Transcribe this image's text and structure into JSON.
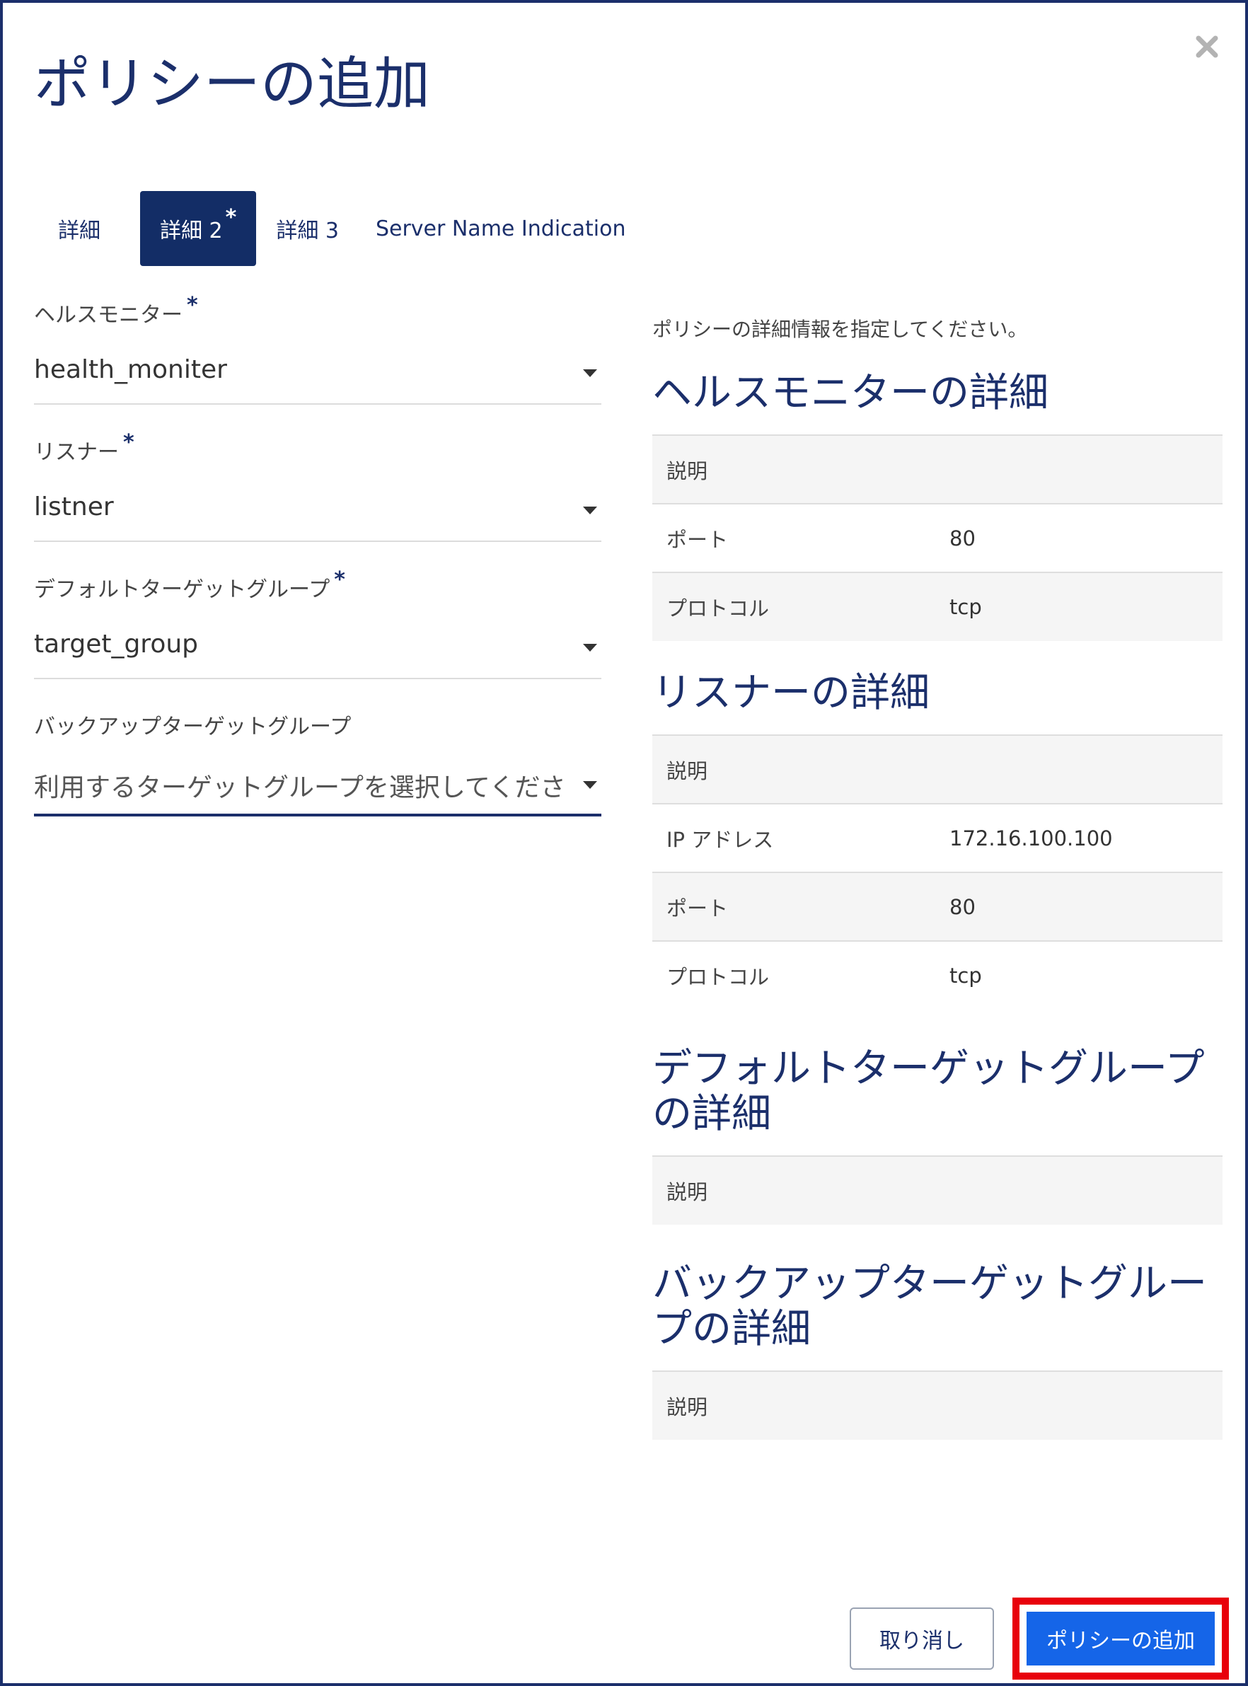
{
  "dialog": {
    "title": "ポリシーの追加",
    "close_icon": "close-icon"
  },
  "tabs": [
    {
      "label": "詳細",
      "active": false
    },
    {
      "label": "詳細 2",
      "active": true,
      "required_mark": "*"
    },
    {
      "label": "詳細 3",
      "active": false
    },
    {
      "label": "Server Name Indication",
      "active": false
    }
  ],
  "form": {
    "health_monitor": {
      "label": "ヘルスモニター",
      "required": "*",
      "value": "health_moniter"
    },
    "listener": {
      "label": "リスナー",
      "required": "*",
      "value": "listner"
    },
    "default_target_group": {
      "label": "デフォルトターゲットグループ",
      "required": "*",
      "value": "target_group"
    },
    "backup_target_group": {
      "label": "バックアップターゲットグループ",
      "placeholder": "利用するターゲットグループを選択してくださ"
    }
  },
  "details": {
    "intro": "ポリシーの詳細情報を指定してください。",
    "health_monitor": {
      "title": "ヘルスモニターの詳細",
      "rows": [
        {
          "key": "説明",
          "value": ""
        },
        {
          "key": "ポート",
          "value": "80"
        },
        {
          "key": "プロトコル",
          "value": "tcp"
        }
      ]
    },
    "listener": {
      "title": "リスナーの詳細",
      "rows": [
        {
          "key": "説明",
          "value": ""
        },
        {
          "key": "IP アドレス",
          "value": "172.16.100.100"
        },
        {
          "key": "ポート",
          "value": "80"
        },
        {
          "key": "プロトコル",
          "value": "tcp"
        }
      ]
    },
    "default_target_group": {
      "title": "デフォルトターゲットグループの詳細",
      "rows": [
        {
          "key": "説明",
          "value": ""
        }
      ]
    },
    "backup_target_group": {
      "title": "バックアップターゲットグループの詳細",
      "rows": [
        {
          "key": "説明",
          "value": ""
        }
      ]
    }
  },
  "footer": {
    "cancel_label": "取り消し",
    "submit_label": "ポリシーの追加"
  },
  "colors": {
    "primary_navy": "#1b2f6b",
    "active_tab": "#132d66",
    "submit_blue": "#1565e8",
    "highlight_red": "#e8000b"
  }
}
